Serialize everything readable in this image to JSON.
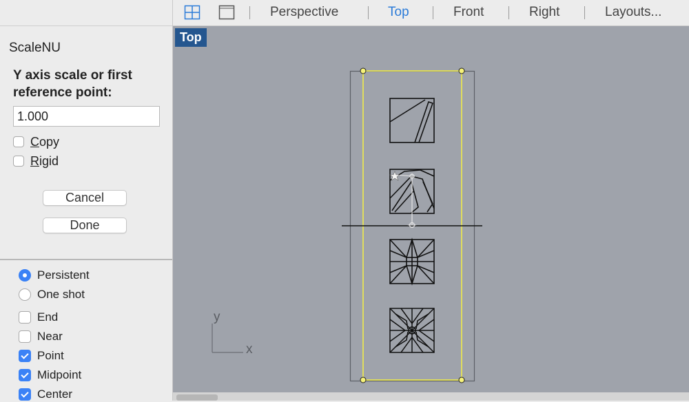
{
  "command": {
    "name": "ScaleNU",
    "prompt": "Y axis scale or first reference point:",
    "value": "1.000",
    "options": [
      {
        "label": "Copy",
        "checked": false
      },
      {
        "label": "Rigid",
        "checked": false
      }
    ],
    "cancel_label": "Cancel",
    "done_label": "Done"
  },
  "osnap": {
    "modes": [
      {
        "label": "Persistent",
        "selected": true
      },
      {
        "label": "One shot",
        "selected": false
      }
    ],
    "snaps": [
      {
        "label": "End",
        "checked": false
      },
      {
        "label": "Near",
        "checked": false
      },
      {
        "label": "Point",
        "checked": true
      },
      {
        "label": "Midpoint",
        "checked": true
      },
      {
        "label": "Center",
        "checked": true
      }
    ]
  },
  "toolbar": {
    "views": [
      {
        "label": "Perspective",
        "active": false
      },
      {
        "label": "Top",
        "active": true
      },
      {
        "label": "Front",
        "active": false
      },
      {
        "label": "Right",
        "active": false
      },
      {
        "label": "Layouts...",
        "active": false
      }
    ],
    "icons": [
      "four-viewports-icon",
      "single-viewport-icon"
    ]
  },
  "viewport": {
    "label": "Top",
    "axis_y": "y",
    "axis_x": "x"
  },
  "colors": {
    "accent": "#3b82f6",
    "active_tab": "#2b7bd8",
    "viewport_bg": "#9fa3ab",
    "viewport_label_bg": "#24568f",
    "selection": "#f0ec4a"
  }
}
